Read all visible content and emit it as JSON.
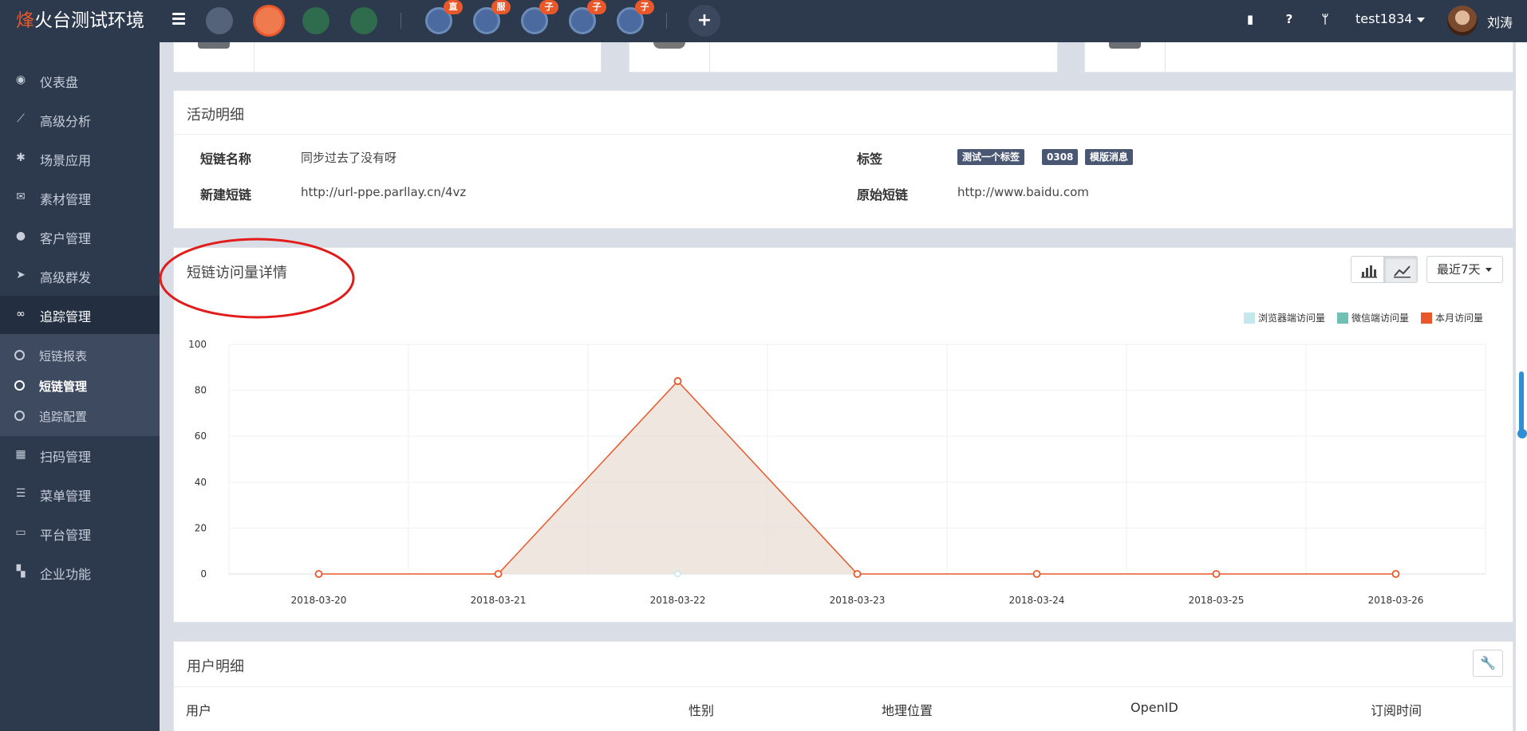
{
  "topbar": {
    "logo_first": "烽",
    "logo_rest": "火台测试环境",
    "badges": [
      "直",
      "服",
      "子",
      "子",
      "子"
    ],
    "username": "test1834",
    "display_name": "刘涛"
  },
  "sidebar": {
    "items": [
      {
        "label": "仪表盘",
        "icon": "dashboard-icon"
      },
      {
        "label": "高级分析",
        "icon": "line-chart-icon"
      },
      {
        "label": "场景应用",
        "icon": "gear-icon"
      },
      {
        "label": "素材管理",
        "icon": "envelope-icon"
      },
      {
        "label": "客户管理",
        "icon": "user-icon"
      },
      {
        "label": "高级群发",
        "icon": "paper-plane-icon"
      },
      {
        "label": "追踪管理",
        "icon": "link-icon"
      },
      {
        "label": "扫码管理",
        "icon": "qrcode-icon"
      },
      {
        "label": "菜单管理",
        "icon": "list-icon"
      },
      {
        "label": "平台管理",
        "icon": "desktop-icon"
      },
      {
        "label": "企业功能",
        "icon": "grid-icon"
      }
    ],
    "subitems": [
      {
        "label": "短链报表"
      },
      {
        "label": "短链管理"
      },
      {
        "label": "追踪配置"
      }
    ]
  },
  "activity": {
    "title": "活动明细",
    "name_label": "短链名称",
    "name_value": "同步过去了没有呀",
    "new_label": "新建短链",
    "new_value": "http://url-ppe.parllay.cn/4vz",
    "tag_label": "标签",
    "tags": [
      "测试一个标签",
      "0308",
      "模版消息"
    ],
    "orig_label": "原始短链",
    "orig_value": "http://www.baidu.com"
  },
  "visits": {
    "title": "短链访问量详情",
    "range": "最近7天"
  },
  "chart_data": {
    "type": "area",
    "x": [
      "2018-03-20",
      "2018-03-21",
      "2018-03-22",
      "2018-03-23",
      "2018-03-24",
      "2018-03-25",
      "2018-03-26"
    ],
    "ylim": [
      0,
      100
    ],
    "yticks": [
      0,
      20,
      40,
      60,
      80,
      100
    ],
    "grid": true,
    "legend_position": "top-right",
    "series": [
      {
        "name": "浏览器端访问量",
        "color": "#c5e8ea",
        "values": [
          0,
          0,
          0,
          0,
          0,
          0,
          0
        ]
      },
      {
        "name": "微信端访问量",
        "color": "#6fc1b3",
        "values": [
          0,
          0,
          0,
          0,
          0,
          0,
          0
        ]
      },
      {
        "name": "本月访问量",
        "color": "#e8582a",
        "values": [
          0,
          0,
          84,
          0,
          0,
          0,
          0
        ]
      }
    ]
  },
  "users": {
    "title": "用户明细",
    "columns": [
      "用户",
      "性别",
      "地理位置",
      "OpenID",
      "订阅时间"
    ]
  }
}
